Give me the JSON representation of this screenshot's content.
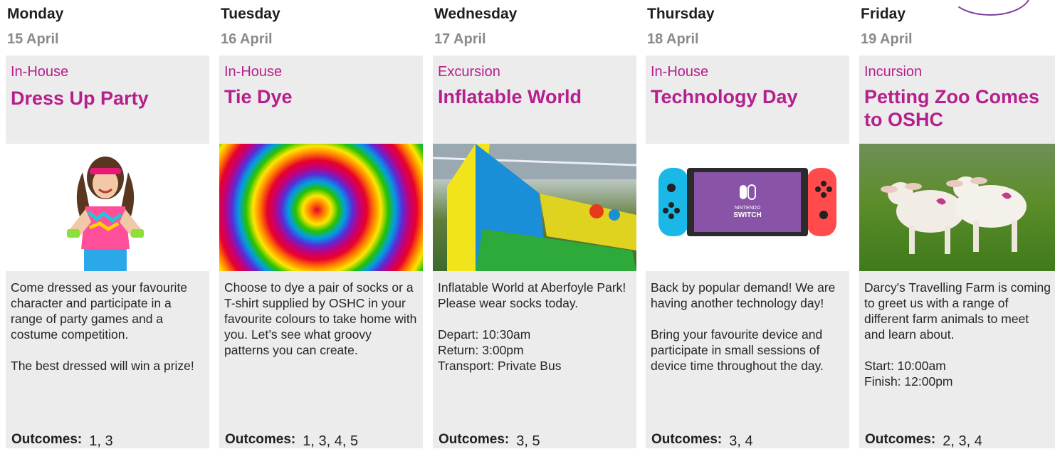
{
  "days": [
    {
      "day": "Monday",
      "date": "15 April",
      "category": "In-House",
      "title": "Dress Up Party",
      "image": "dress-up-girl-photo",
      "paragraphs": [
        "Come dressed as your favourite character and participate in a range of party games and a costume competition.",
        "The best dressed will win a prize!"
      ],
      "outcomes_label": "Outcomes:",
      "outcomes": "1, 3"
    },
    {
      "day": "Tuesday",
      "date": "16 April",
      "category": "In-House",
      "title": "Tie Dye",
      "image": "tie-dye-swirl-photo",
      "paragraphs": [
        "Choose to dye a pair of socks or a T-shirt supplied by OSHC in your favourite colours to take home with you. Let’s see what groovy patterns you can create."
      ],
      "outcomes_label": "Outcomes:",
      "outcomes": "1, 3, 4, 5"
    },
    {
      "day": "Wednesday",
      "date": "17 April",
      "category": "Excursion",
      "title": "Inflatable World",
      "image": "inflatable-slide-photo",
      "paragraphs": [
        "Inflatable World at Aberfoyle Park! Please wear socks today."
      ],
      "details": [
        "Depart: 10:30am",
        "Return: 3:00pm",
        "Transport: Private Bus"
      ],
      "outcomes_label": "Outcomes:",
      "outcomes": "3, 5"
    },
    {
      "day": "Thursday",
      "date": "18 April",
      "category": "In-House",
      "title": "Technology Day",
      "image": "nintendo-switch-photo",
      "brand_text": [
        "NINTENDO",
        "SWITCH"
      ],
      "paragraphs": [
        "Back by popular demand! We are having another technology day!",
        "Bring your favourite device and participate in small sessions of device time throughout the day."
      ],
      "outcomes_label": "Outcomes:",
      "outcomes": "3, 4"
    },
    {
      "day": "Friday",
      "date": "19 April",
      "category": "Incursion",
      "title": "Petting Zoo Comes to OSHC",
      "image": "lambs-photo",
      "paragraphs": [
        "Darcy's Travelling Farm is coming to greet us with a range of different farm animals to meet and learn about."
      ],
      "details": [
        "Start: 10:00am",
        "Finish: 12:00pm"
      ],
      "outcomes_label": "Outcomes:",
      "outcomes": "2, 3, 4"
    }
  ],
  "colors": {
    "accent": "#b5208c",
    "panel": "#ececec",
    "date": "#8a8a8a",
    "decoration": "#7b3fa0"
  }
}
